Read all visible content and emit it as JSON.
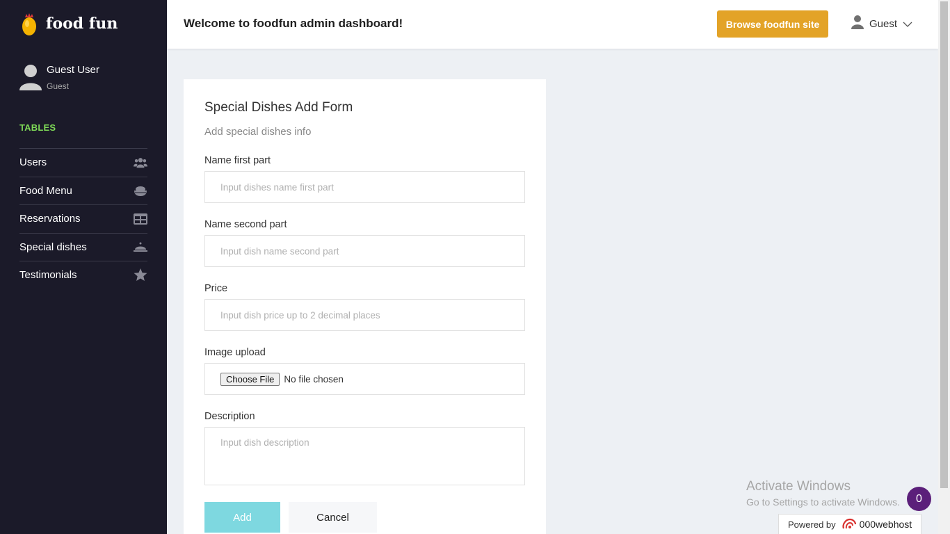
{
  "sidebar": {
    "logo_text": "food fun",
    "profile": {
      "name": "Guest User",
      "role": "Guest"
    },
    "section_heading": "TABLES",
    "items": [
      {
        "label": "Users",
        "icon": "users-icon"
      },
      {
        "label": "Food Menu",
        "icon": "food-bowl-icon"
      },
      {
        "label": "Reservations",
        "icon": "table-icon"
      },
      {
        "label": "Special dishes",
        "icon": "cloche-icon"
      },
      {
        "label": "Testimonials",
        "icon": "star-icon"
      }
    ]
  },
  "header": {
    "welcome": "Welcome to foodfun admin dashboard!",
    "browse_button": "Browse foodfun site",
    "user_menu_label": "Guest"
  },
  "form": {
    "title": "Special Dishes Add Form",
    "subtitle": "Add special dishes info",
    "name_first": {
      "label": "Name first part",
      "placeholder": "Input dishes name first part",
      "value": ""
    },
    "name_second": {
      "label": "Name second part",
      "placeholder": "Input dish name second part",
      "value": ""
    },
    "price": {
      "label": "Price",
      "placeholder": "Input dish price up to 2 decimal places",
      "value": ""
    },
    "image": {
      "label": "Image upload",
      "choose_label": "Choose File",
      "status": "No file chosen"
    },
    "description": {
      "label": "Description",
      "placeholder": "Input dish description",
      "value": ""
    },
    "add_label": "Add",
    "cancel_label": "Cancel"
  },
  "overlay": {
    "activate_title": "Activate Windows",
    "activate_sub": "Go to Settings to activate Windows.",
    "badge_count": "0",
    "powered_by": "Powered by",
    "powered_brand": "000webhost"
  },
  "colors": {
    "sidebar_bg": "#1b1a29",
    "accent_orange": "#e3a327",
    "tables_green": "#7ed957",
    "add_button": "#7ed8e0",
    "badge_purple": "#5b1f7a"
  }
}
